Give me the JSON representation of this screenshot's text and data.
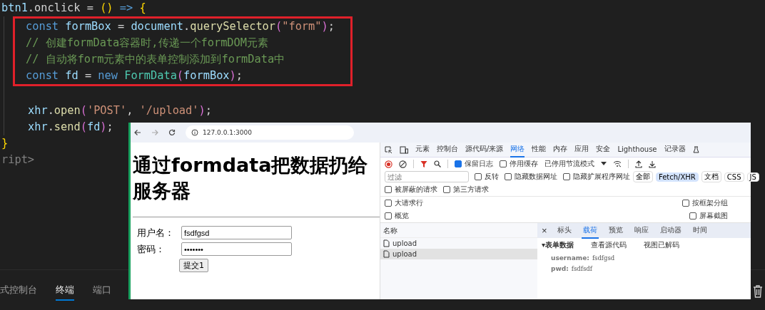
{
  "editor": {
    "lines": [
      {
        "kind": "code",
        "highlighted": false,
        "tokens": [
          {
            "t": "btn1",
            "kind": "variable"
          },
          {
            "t": ".onclick = ",
            "kind": "punct"
          },
          {
            "t": "()",
            "kind": "bracket1"
          },
          {
            "t": " => ",
            "kind": "keyword"
          },
          {
            "t": "{",
            "kind": "bracket1"
          }
        ],
        "children": [
          {
            "kind": "code",
            "highlighted": true,
            "tokens": [
              {
                "t": "const ",
                "kind": "keyword"
              },
              {
                "t": "formBox",
                "kind": "variable"
              },
              {
                "t": " = ",
                "kind": "punct"
              },
              {
                "t": "document",
                "kind": "variable"
              },
              {
                "t": ".",
                "kind": "punct"
              },
              {
                "t": "querySelector",
                "kind": "function"
              },
              {
                "t": "(",
                "kind": "bracket2"
              },
              {
                "t": "\"form\"",
                "kind": "string"
              },
              {
                "t": ")",
                "kind": "bracket2"
              },
              {
                "t": ";",
                "kind": "punct"
              }
            ]
          },
          {
            "kind": "code",
            "highlighted": true,
            "tokens": [
              {
                "t": "// 创建formData容器时,传递一个formDOM元素",
                "kind": "comment"
              }
            ]
          },
          {
            "kind": "code",
            "highlighted": true,
            "tokens": [
              {
                "t": "// 自动将form元素中的表单控制添加到formData中",
                "kind": "comment"
              }
            ]
          },
          {
            "kind": "code",
            "highlighted": true,
            "tokens": [
              {
                "t": "const ",
                "kind": "keyword"
              },
              {
                "t": "fd",
                "kind": "variable"
              },
              {
                "t": " = ",
                "kind": "punct"
              },
              {
                "t": "new ",
                "kind": "keyword"
              },
              {
                "t": "FormData",
                "kind": "class"
              },
              {
                "t": "(",
                "kind": "bracket2"
              },
              {
                "t": "formBox",
                "kind": "variable"
              },
              {
                "t": ")",
                "kind": "bracket2"
              },
              {
                "t": ";",
                "kind": "punct"
              }
            ]
          },
          {
            "kind": "blank",
            "highlighted": false
          },
          {
            "kind": "code",
            "highlighted": false,
            "tokens": [
              {
                "t": "xhr",
                "kind": "variable"
              },
              {
                "t": ".",
                "kind": "punct"
              },
              {
                "t": "open",
                "kind": "function"
              },
              {
                "t": "(",
                "kind": "bracket2"
              },
              {
                "t": "'POST'",
                "kind": "string"
              },
              {
                "t": ", ",
                "kind": "punct"
              },
              {
                "t": "'/upload'",
                "kind": "string"
              },
              {
                "t": ")",
                "kind": "bracket2"
              },
              {
                "t": ";",
                "kind": "punct"
              }
            ]
          },
          {
            "kind": "code",
            "highlighted": false,
            "tokens": [
              {
                "t": "xhr",
                "kind": "variable"
              },
              {
                "t": ".",
                "kind": "punct"
              },
              {
                "t": "send",
                "kind": "function"
              },
              {
                "t": "(",
                "kind": "bracket2"
              },
              {
                "t": "fd",
                "kind": "variable"
              },
              {
                "t": ")",
                "kind": "bracket2"
              },
              {
                "t": ";",
                "kind": "punct"
              }
            ]
          }
        ]
      },
      {
        "kind": "code",
        "highlighted": false,
        "tokens": [
          {
            "t": "}",
            "kind": "bracket1"
          }
        ]
      },
      {
        "kind": "code",
        "highlighted": false,
        "tokens": [
          {
            "t": "ript>",
            "kind": "tag"
          }
        ]
      }
    ]
  },
  "panel_tabs": [
    {
      "label": "式控制台",
      "selected": false
    },
    {
      "label": "终端",
      "selected": true
    },
    {
      "label": "端口",
      "selected": false
    }
  ],
  "browser": {
    "url": "127.0.0.1:3000",
    "page": {
      "heading": "通过formdata把数据扔给服务器",
      "fields": [
        {
          "label": "用户名：",
          "value": "fsdfgsd"
        },
        {
          "label": "密码：",
          "value": "•••••••"
        }
      ],
      "submit": "提交1"
    },
    "devtools": {
      "tabs": [
        {
          "label": "元素",
          "selected": false
        },
        {
          "label": "控制台",
          "selected": false
        },
        {
          "label": "源代码/来源",
          "selected": false
        },
        {
          "label": "网络",
          "selected": true
        },
        {
          "label": "性能",
          "selected": false
        },
        {
          "label": "内存",
          "selected": false
        },
        {
          "label": "应用",
          "selected": false
        },
        {
          "label": "安全",
          "selected": false
        },
        {
          "label": "Lighthouse",
          "selected": false
        },
        {
          "label": "记录器",
          "selected": false
        }
      ],
      "toolbar": {
        "checks": [
          {
            "label": "保留日志",
            "checked": true
          },
          {
            "label": "停用缓存",
            "checked": false
          }
        ],
        "throttle": "已停用节流模式"
      },
      "filter": {
        "placeholder": "过滤",
        "options": [
          {
            "label": "反转",
            "checked": false
          },
          {
            "label": "隐藏数据网址",
            "checked": false
          },
          {
            "label": "隐藏扩展程序网址",
            "checked": false
          }
        ],
        "types": [
          {
            "label": "全部",
            "selected": false
          },
          {
            "label": "Fetch/XHR",
            "selected": true
          },
          {
            "label": "文档",
            "selected": false
          },
          {
            "label": "CSS",
            "selected": false
          },
          {
            "label": "JS",
            "selected": false
          }
        ]
      },
      "blocked": [
        {
          "label": "被屏蔽的请求",
          "checked": false
        },
        {
          "label": "第三方请求",
          "checked": false
        }
      ],
      "settings": [
        {
          "left": {
            "label": "大请求行",
            "checked": false
          },
          "right": {
            "label": "按框架分组",
            "checked": false
          }
        },
        {
          "left": {
            "label": "概览",
            "checked": false
          },
          "right": {
            "label": "屏幕截图",
            "checked": false
          }
        }
      ],
      "requests": {
        "header": "名称",
        "rows": [
          {
            "name": "upload",
            "selected": false
          },
          {
            "name": "upload",
            "selected": true
          }
        ]
      },
      "details": {
        "close": "×",
        "tabs": [
          {
            "label": "标头",
            "selected": false
          },
          {
            "label": "载荷",
            "selected": true
          },
          {
            "label": "预览",
            "selected": false
          },
          {
            "label": "响应",
            "selected": false
          },
          {
            "label": "启动器",
            "selected": false
          },
          {
            "label": "时间",
            "selected": false
          }
        ],
        "section": "▾表单数据",
        "actions": [
          "查看源代码",
          "视图已解码"
        ],
        "fields": [
          {
            "key": "username:",
            "value": "fsdfgsd"
          },
          {
            "key": "pwd:",
            "value": "fsdfsdf"
          }
        ]
      }
    }
  }
}
